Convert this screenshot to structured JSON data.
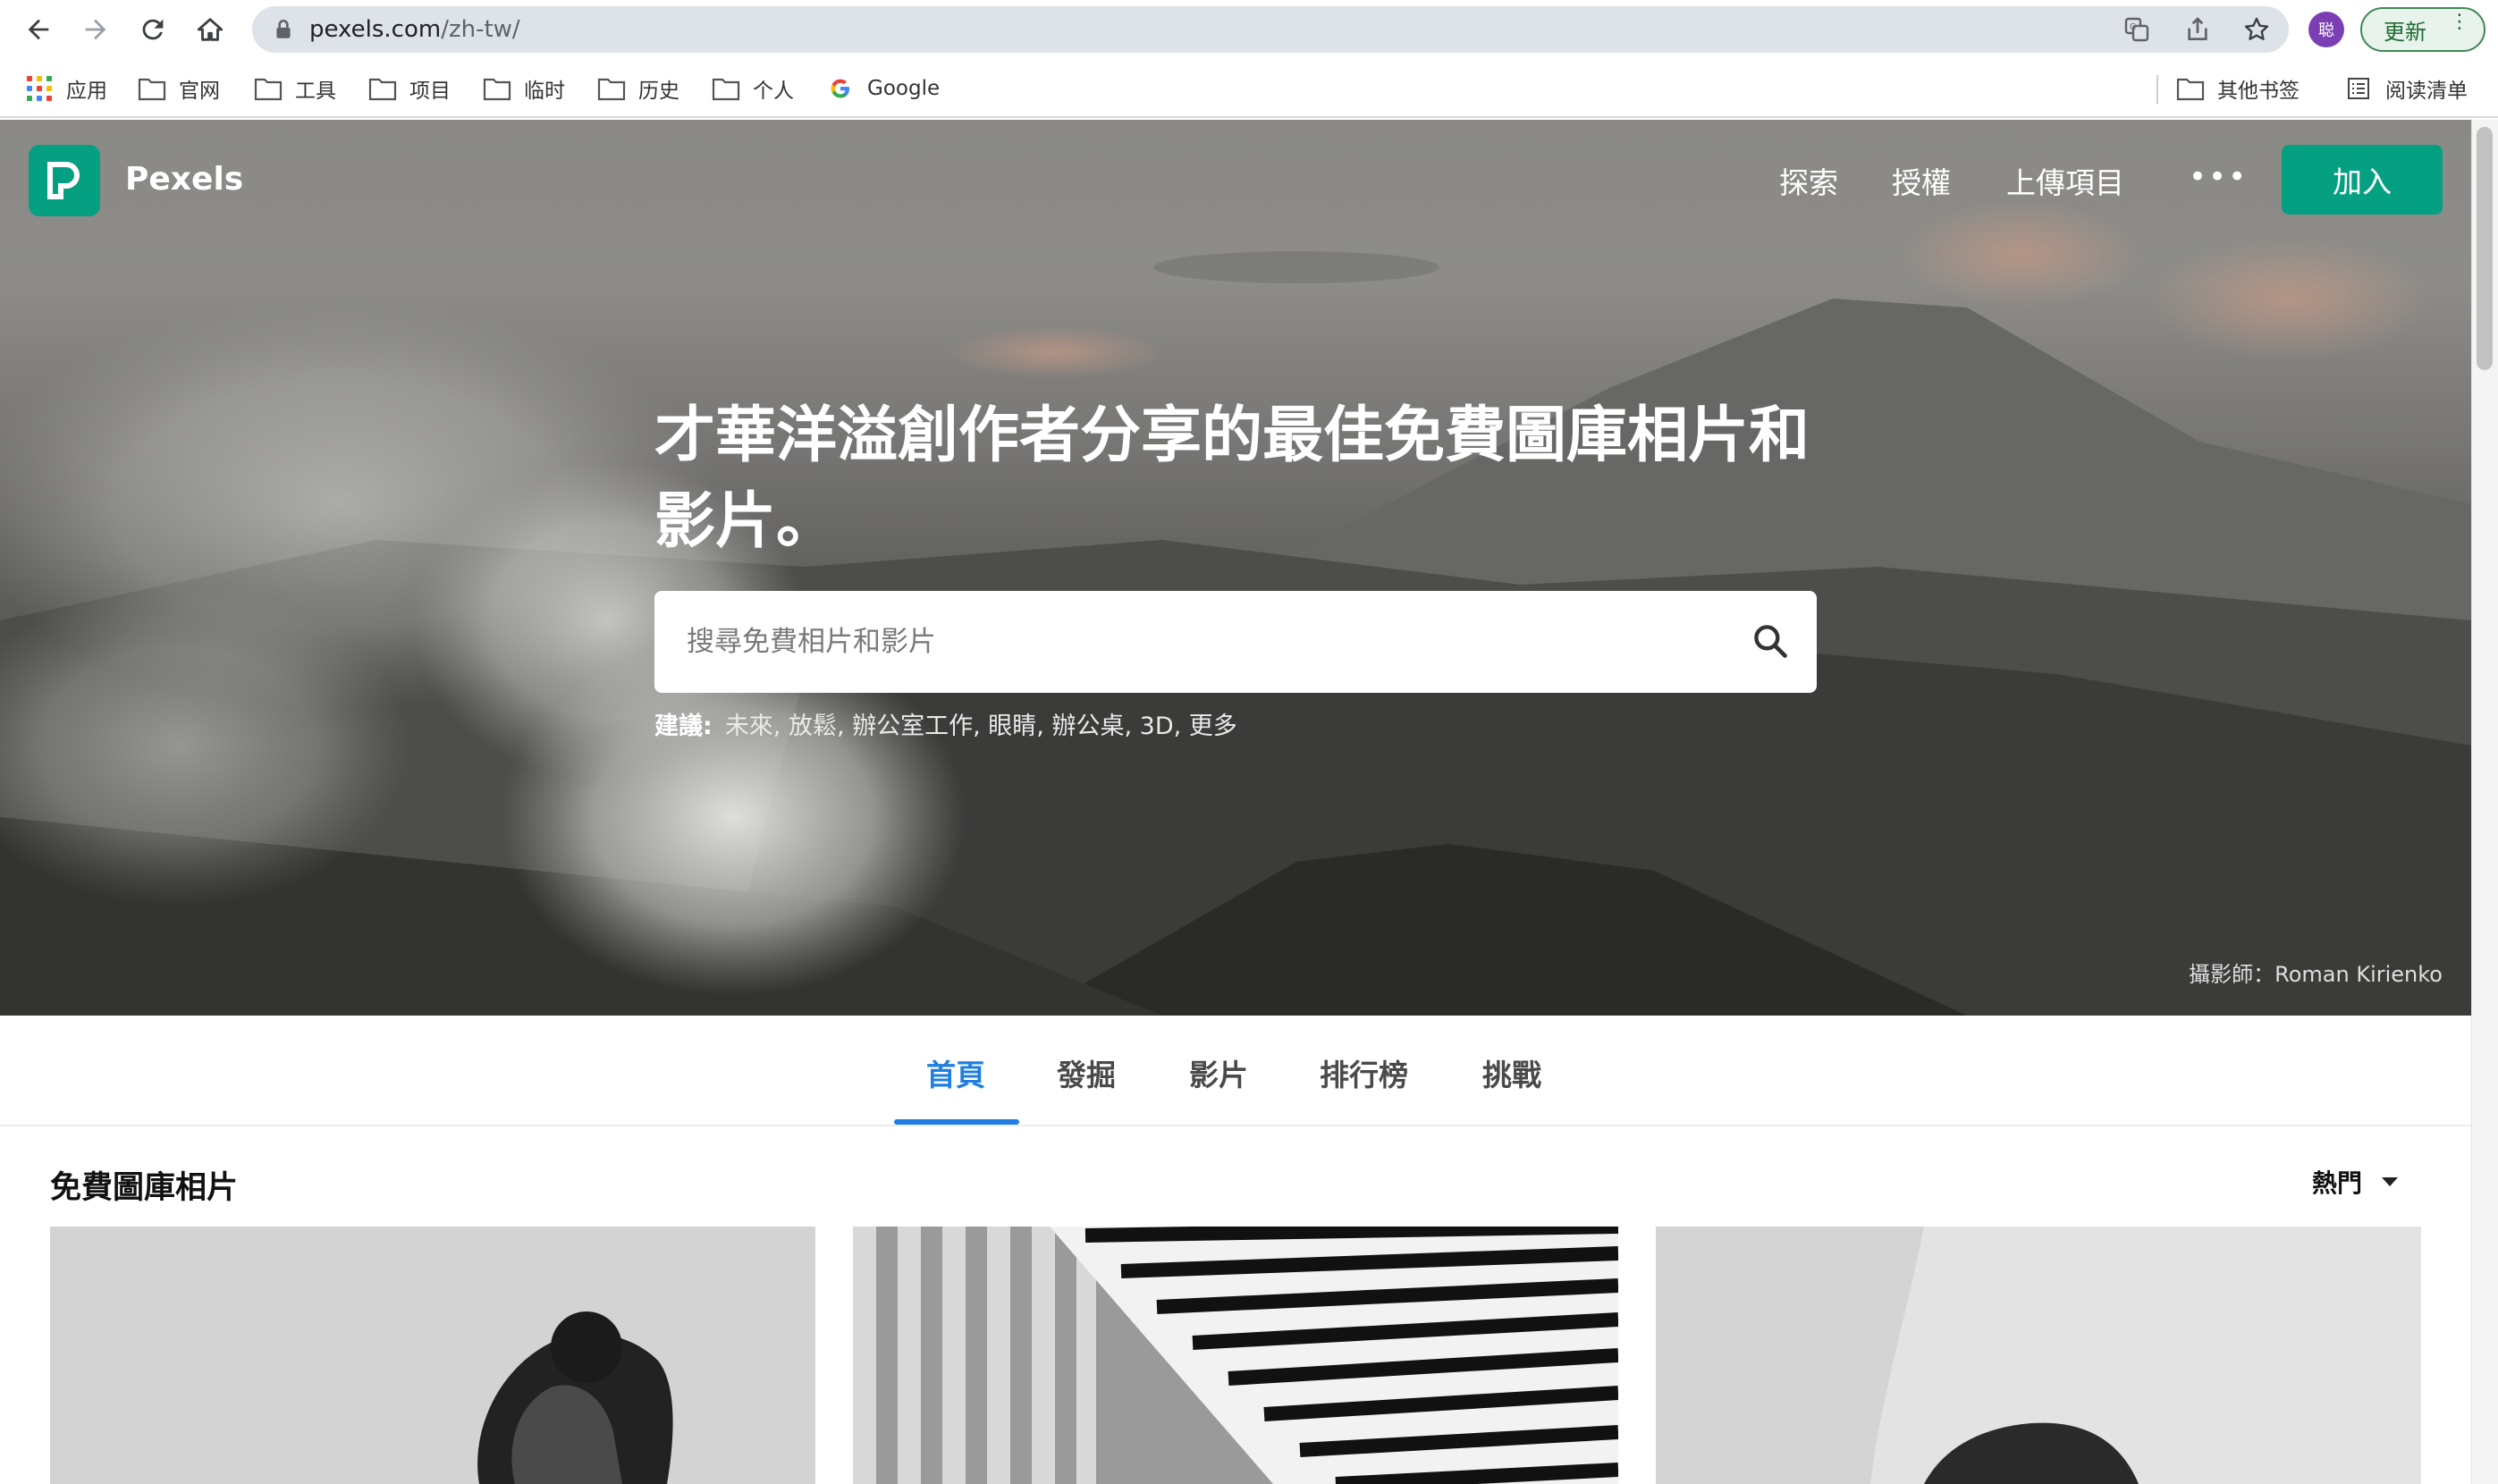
{
  "browser": {
    "url_host": "pexels.com",
    "url_path": "/zh-tw/",
    "profile_initial": "聪",
    "update_label": "更新",
    "bookmarks": [
      {
        "icon": "apps-grid-icon",
        "label": "应用"
      },
      {
        "icon": "folder-icon",
        "label": "官网"
      },
      {
        "icon": "folder-icon",
        "label": "工具"
      },
      {
        "icon": "folder-icon",
        "label": "项目"
      },
      {
        "icon": "folder-icon",
        "label": "临时"
      },
      {
        "icon": "folder-icon",
        "label": "历史"
      },
      {
        "icon": "folder-icon",
        "label": "个人"
      },
      {
        "icon": "google-icon",
        "label": "Google"
      }
    ],
    "other_bookmarks": "其他书签",
    "reading_list": "阅读清单"
  },
  "header": {
    "logo_text": "Pexels",
    "nav": [
      "探索",
      "授權",
      "上傳項目"
    ],
    "more": "•••",
    "join_label": "加入"
  },
  "hero": {
    "headline": "才華洋溢創作者分享的最佳免費圖庫相片和影片。",
    "search_placeholder": "搜尋免費相片和影片",
    "suggest_label": "建議:",
    "suggestions": "未來, 放鬆, 辦公室工作, 眼睛, 辦公桌, 3D, 更多",
    "credit": "攝影師：Roman Kirienko"
  },
  "tabs": {
    "items": [
      "首頁",
      "發掘",
      "影片",
      "排行榜",
      "挑戰"
    ],
    "active": "首頁"
  },
  "gallery": {
    "title": "免費圖庫相片",
    "sort_label": "熱門"
  },
  "colors": {
    "brand": "#05a081",
    "active_tab": "#1f7fe0"
  }
}
